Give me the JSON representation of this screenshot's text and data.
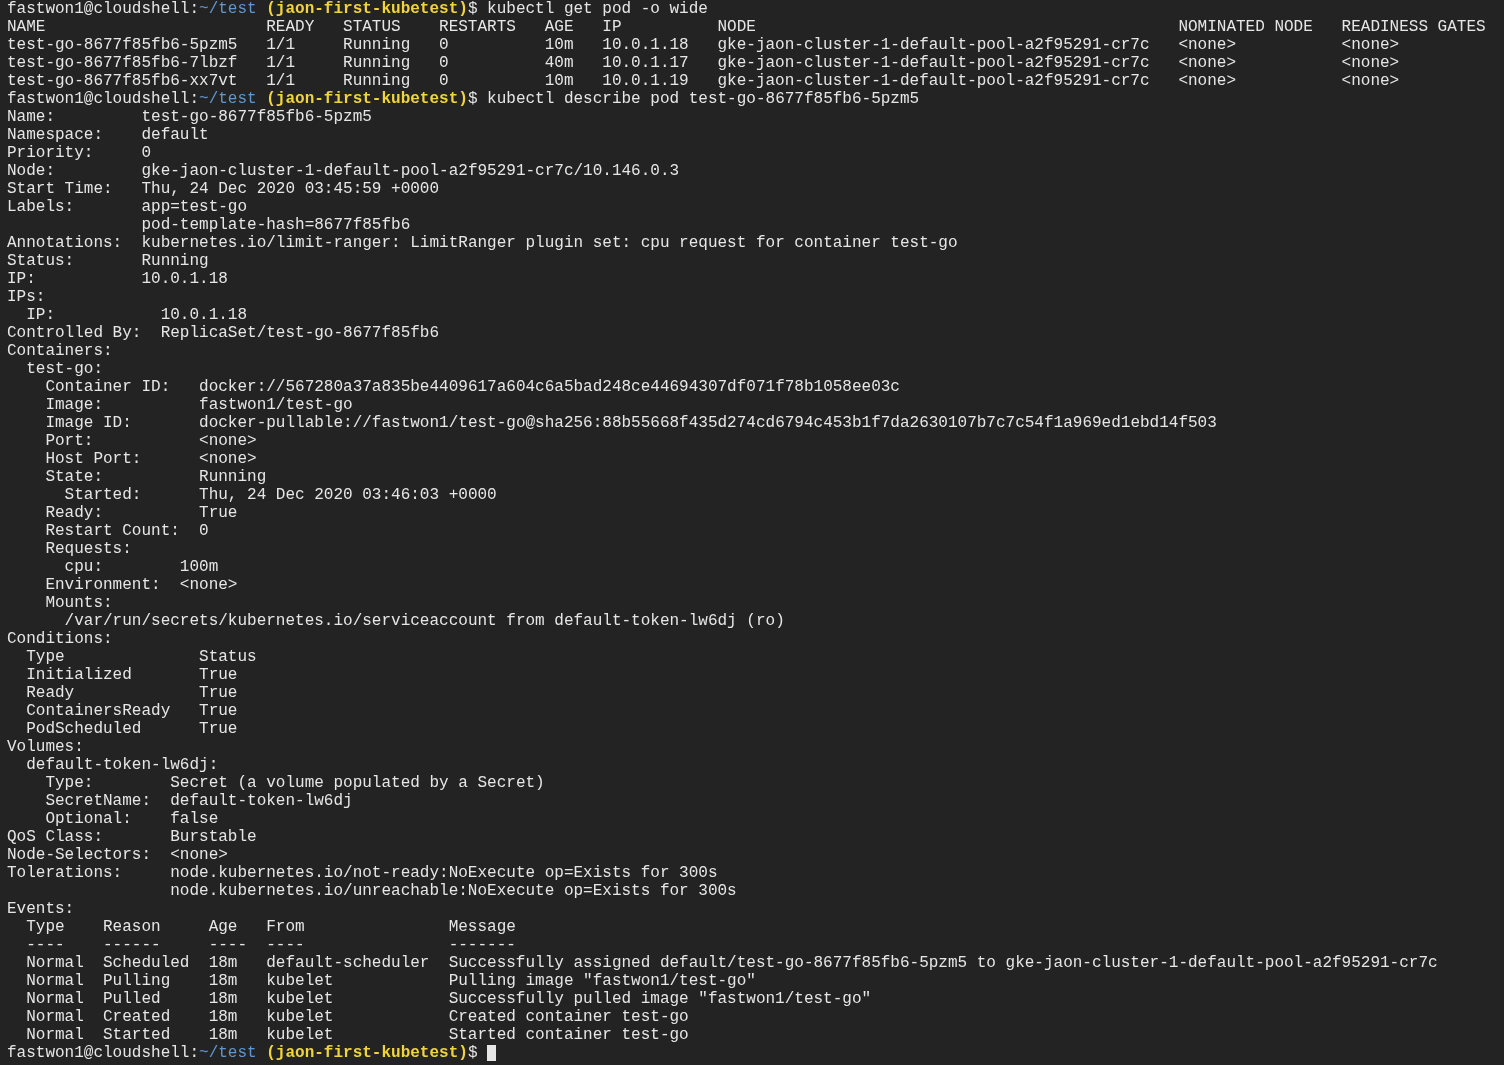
{
  "terminal": {
    "lines": [
      {
        "kind": "prompt",
        "user": "fastwon1@cloudshell:",
        "path": "~/test",
        "project": "(jaon-first-kubetest)",
        "symbol": "$",
        "command": "kubectl get pod -o wide",
        "cursor": false
      },
      {
        "kind": "table",
        "columns": [
          "NAME",
          "READY",
          "STATUS",
          "RESTARTS",
          "AGE",
          "IP",
          "NODE",
          "NOMINATED NODE",
          "READINESS GATES"
        ],
        "rows": [
          [
            "test-go-8677f85fb6-5pzm5",
            "1/1",
            "Running",
            "0",
            "10m",
            "10.0.1.18",
            "gke-jaon-cluster-1-default-pool-a2f95291-cr7c",
            "<none>",
            "<none>"
          ],
          [
            "test-go-8677f85fb6-7lbzf",
            "1/1",
            "Running",
            "0",
            "40m",
            "10.0.1.17",
            "gke-jaon-cluster-1-default-pool-a2f95291-cr7c",
            "<none>",
            "<none>"
          ],
          [
            "test-go-8677f85fb6-xx7vt",
            "1/1",
            "Running",
            "0",
            "10m",
            "10.0.1.19",
            "gke-jaon-cluster-1-default-pool-a2f95291-cr7c",
            "<none>",
            "<none>"
          ]
        ]
      },
      {
        "kind": "prompt",
        "user": "fastwon1@cloudshell:",
        "path": "~/test",
        "project": "(jaon-first-kubetest)",
        "symbol": "$",
        "command": "kubectl describe pod test-go-8677f85fb6-5pzm5",
        "cursor": false
      },
      {
        "kind": "describe",
        "items": [
          {
            "kind": "field",
            "label": "Name:",
            "values": [
              "test-go-8677f85fb6-5pzm5"
            ]
          },
          {
            "kind": "field",
            "label": "Namespace:",
            "values": [
              "default"
            ]
          },
          {
            "kind": "field",
            "label": "Priority:",
            "values": [
              "0"
            ]
          },
          {
            "kind": "field",
            "label": "Node:",
            "values": [
              "gke-jaon-cluster-1-default-pool-a2f95291-cr7c/10.146.0.3"
            ]
          },
          {
            "kind": "field",
            "label": "Start Time:",
            "values": [
              "Thu, 24 Dec 2020 03:45:59 +0000"
            ]
          },
          {
            "kind": "field",
            "label": "Labels:",
            "values": [
              "app=test-go",
              "pod-template-hash=8677f85fb6"
            ]
          },
          {
            "kind": "field",
            "label": "Annotations:",
            "values": [
              "kubernetes.io/limit-ranger: LimitRanger plugin set: cpu request for container test-go"
            ]
          },
          {
            "kind": "field",
            "label": "Status:",
            "values": [
              "Running"
            ]
          },
          {
            "kind": "field",
            "label": "IP:",
            "values": [
              "10.0.1.18"
            ]
          },
          {
            "kind": "field",
            "label": "IPs:",
            "children": [
              {
                "kind": "field",
                "label": "IP:",
                "values": [
                  "10.0.1.18"
                ]
              }
            ]
          },
          {
            "kind": "field",
            "label": "Controlled By:",
            "values": [
              "ReplicaSet/test-go-8677f85fb6"
            ]
          },
          {
            "kind": "field",
            "label": "Containers:",
            "children": [
              {
                "kind": "field",
                "label": "test-go:",
                "children": [
                  {
                    "kind": "field",
                    "label": "Container ID:",
                    "values": [
                      "docker://567280a37a835be4409617a604c6a5bad248ce44694307df071f78b1058ee03c"
                    ]
                  },
                  {
                    "kind": "field",
                    "label": "Image:",
                    "values": [
                      "fastwon1/test-go"
                    ]
                  },
                  {
                    "kind": "field",
                    "label": "Image ID:",
                    "values": [
                      "docker-pullable://fastwon1/test-go@sha256:88b55668f435d274cd6794c453b1f7da2630107b7c7c54f1a969ed1ebd14f503"
                    ]
                  },
                  {
                    "kind": "field",
                    "label": "Port:",
                    "values": [
                      "<none>"
                    ]
                  },
                  {
                    "kind": "field",
                    "label": "Host Port:",
                    "values": [
                      "<none>"
                    ]
                  },
                  {
                    "kind": "field",
                    "label": "State:",
                    "values": [
                      "Running"
                    ],
                    "children": [
                      {
                        "kind": "field",
                        "label": "Started:",
                        "values": [
                          "Thu, 24 Dec 2020 03:46:03 +0000"
                        ]
                      }
                    ]
                  },
                  {
                    "kind": "field",
                    "label": "Ready:",
                    "values": [
                      "True"
                    ]
                  },
                  {
                    "kind": "field",
                    "label": "Restart Count:",
                    "values": [
                      "0"
                    ]
                  },
                  {
                    "kind": "field",
                    "label": "Requests:",
                    "children": [
                      {
                        "kind": "field",
                        "label": "cpu:",
                        "values": [
                          "100m"
                        ]
                      }
                    ]
                  },
                  {
                    "kind": "field",
                    "label": "Environment:",
                    "values": [
                      "<none>"
                    ]
                  },
                  {
                    "kind": "field",
                    "label": "Mounts:",
                    "children": [
                      {
                        "kind": "text",
                        "text": "/var/run/secrets/kubernetes.io/serviceaccount from default-token-lw6dj (ro)"
                      }
                    ]
                  }
                ]
              }
            ]
          },
          {
            "kind": "field",
            "label": "Conditions:",
            "children": [
              {
                "kind": "table",
                "columns": [
                  "Type",
                  "Status"
                ],
                "rows": [
                  [
                    "Initialized",
                    "True"
                  ],
                  [
                    "Ready",
                    "True"
                  ],
                  [
                    "ContainersReady",
                    "True"
                  ],
                  [
                    "PodScheduled",
                    "True"
                  ]
                ]
              }
            ]
          },
          {
            "kind": "field",
            "label": "Volumes:",
            "children": [
              {
                "kind": "field",
                "label": "default-token-lw6dj:",
                "children": [
                  {
                    "kind": "field",
                    "label": "Type:",
                    "values": [
                      "Secret (a volume populated by a Secret)"
                    ]
                  },
                  {
                    "kind": "field",
                    "label": "SecretName:",
                    "values": [
                      "default-token-lw6dj"
                    ]
                  },
                  {
                    "kind": "field",
                    "label": "Optional:",
                    "values": [
                      "false"
                    ]
                  }
                ]
              }
            ]
          },
          {
            "kind": "field",
            "label": "QoS Class:",
            "values": [
              "Burstable"
            ]
          },
          {
            "kind": "field",
            "label": "Node-Selectors:",
            "values": [
              "<none>"
            ]
          },
          {
            "kind": "field",
            "label": "Tolerations:",
            "values": [
              "node.kubernetes.io/not-ready:NoExecute op=Exists for 300s",
              "node.kubernetes.io/unreachable:NoExecute op=Exists for 300s"
            ]
          },
          {
            "kind": "field",
            "label": "Events:",
            "children": [
              {
                "kind": "events",
                "columns": [
                  "Type",
                  "Reason",
                  "Age",
                  "From",
                  "Message"
                ],
                "rows": [
                  [
                    "----",
                    "------",
                    "----",
                    "----",
                    "-------"
                  ],
                  [
                    "Normal",
                    "Scheduled",
                    "18m",
                    "default-scheduler",
                    "Successfully assigned default/test-go-8677f85fb6-5pzm5 to gke-jaon-cluster-1-default-pool-a2f95291-cr7c"
                  ],
                  [
                    "Normal",
                    "Pulling",
                    "18m",
                    "kubelet",
                    "Pulling image \"fastwon1/test-go\""
                  ],
                  [
                    "Normal",
                    "Pulled",
                    "18m",
                    "kubelet",
                    "Successfully pulled image \"fastwon1/test-go\""
                  ],
                  [
                    "Normal",
                    "Created",
                    "18m",
                    "kubelet",
                    "Created container test-go"
                  ],
                  [
                    "Normal",
                    "Started",
                    "18m",
                    "kubelet",
                    "Started container test-go"
                  ]
                ]
              }
            ]
          }
        ]
      },
      {
        "kind": "prompt",
        "user": "fastwon1@cloudshell:",
        "path": "~/test",
        "project": "(jaon-first-kubetest)",
        "symbol": "$",
        "cursor": true
      }
    ]
  }
}
